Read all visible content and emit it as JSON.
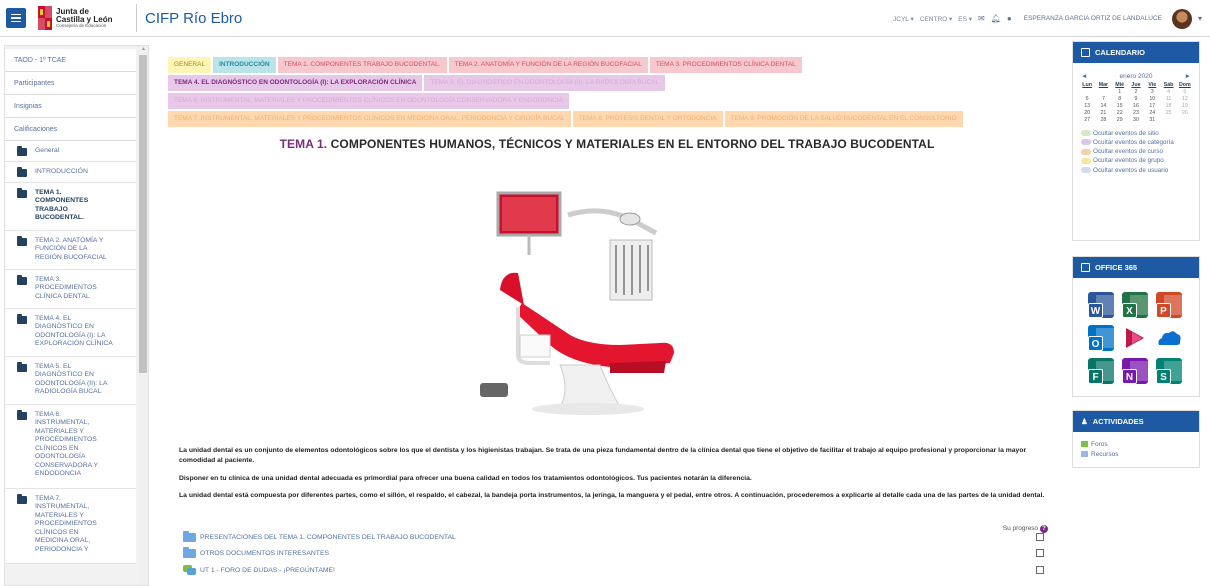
{
  "header": {
    "logo_line1": "Junta de",
    "logo_line2": "Castilla y León",
    "logo_line3": "Consejería de Educación",
    "site_name": "CIFP Río Ebro",
    "nav_jcyl": "JCYL",
    "nav_centro": "CENTRO",
    "nav_lang": "ES",
    "user_name": "ESPERANZA GARCIA ORTIZ DE LANDALUCE"
  },
  "drawer": {
    "course": "TAOD - 1º TCAE",
    "links": [
      "Participantes",
      "Insignias",
      "Calificaciones"
    ],
    "sections": [
      {
        "label": "General",
        "lines": [
          "General"
        ]
      },
      {
        "label": "INTRODUCCIÓN",
        "lines": [
          "INTRODUCCIÓN"
        ]
      },
      {
        "label": "TEMA 1. COMPONENTES TRABAJO BUCODENTAL.",
        "lines": [
          "TEMA 1.",
          "COMPONENTES",
          "TRABAJO",
          "BUCODENTAL."
        ],
        "active": true
      },
      {
        "label": "TEMA 2. ANATOMÍA Y FUNCIÓN DE LA REGIÓN BUCOFACIAL",
        "lines": [
          "TEMA 2. ANATOMÍA Y",
          "FUNCIÓN DE LA",
          "REGIÓN BUCOFACIAL"
        ]
      },
      {
        "label": "TEMA 3. PROCEDIMIENTOS CLÍNICA DENTAL",
        "lines": [
          "TEMA 3.",
          "PROCEDIMIENTOS",
          "CLÍNICA DENTAL"
        ]
      },
      {
        "label": "TEMA 4. EL DIAGNÓSTICO EN ODONTOLOGÍA (I): LA EXPLORACIÓN CLÍNICA",
        "lines": [
          "TEMA 4. EL",
          "DIAGNÓSTICO EN",
          "ODONTOLOGÍA (I): LA",
          "EXPLORACIÓN CLÍNICA"
        ]
      },
      {
        "label": "TEMA 5. EL DIAGNÓSTICO EN ODONTOLOGÍA (II): LA RADIOLOGÍA BUCAL",
        "lines": [
          "TEMA 5. EL",
          "DIAGNÓSTICO EN",
          "ODONTOLOGÍA (II): LA",
          "RADIOLOGÍA BUCAL"
        ]
      },
      {
        "label": "TEMA 6. INSTRUMENTAL, MATERIALES Y PROCEDIMIENTOS CLÍNICOS EN ODONTOLOGÍA CONSERVADORA Y ENDODONCIA",
        "lines": [
          "TEMA 6.",
          "INSTRUMENTAL,",
          "MATERIALES Y",
          "PROCEDIMIENTOS",
          "CLÍNICOS EN",
          "ODONTOLOGÍA",
          "CONSERVADORA Y",
          "ENDODONCIA"
        ]
      },
      {
        "label": "TEMA 7. INSTRUMENTAL, MATERIALES Y PROCEDIMIENTOS CLÍNICOS EN MEDICINA ORAL, PERIODONCIA Y",
        "lines": [
          "TEMA 7.",
          "INSTRUMENTAL,",
          "MATERIALES Y",
          "PROCEDIMIENTOS",
          "CLÍNICOS EN",
          "MEDICINA ORAL,",
          "PERIODONCIA Y"
        ]
      }
    ]
  },
  "tabs": {
    "row1": [
      "General",
      "INTRODUCCIÓN",
      "TEMA 1. COMPONENTES TRABAJO BUCODENTAL.",
      "TEMA 2. ANATOMÍA Y FUNCIÓN DE LA REGIÓN BUCOFACIAL",
      "TEMA 3. PROCEDIMIENTOS CLÍNICA DENTAL"
    ],
    "row2": [
      "TEMA 4. EL DIAGNÓSTICO EN ODONTOLOGÍA (I): LA EXPLORACIÓN CLÍNICA",
      "TEMA 5. EL DIAGNÓSTICO EN ODONTOLOGÍA (II): LA RADIOLOGÍA BUCAL"
    ],
    "row3": [
      "TEMA 6. INSTRUMENTAL, MATERIALES Y PROCEDIMIENTOS CLÍNICOS EN ODONTOLOGÍA CONSERVADORA Y ENDODONCIA"
    ],
    "row4": [
      "TEMA 7. INSTRUMENTAL, MATERIALES Y PROCEDIMIENTOS CLÍNICOS EN MEDICINA ORAL, PERIODONCIA Y CIRUGÍA BUCAL",
      "TEMA 8. PRÓTESIS DENTAL Y ORTODONCIA",
      "TEMA 9. PROMOCIÓN DE LA SALUD BUCODENTAL EN EL CONSULTORIO"
    ]
  },
  "content": {
    "title_prefix": "TEMA 1.",
    "title_rest": " COMPONENTES HUMANOS, TÉCNICOS Y MATERIALES EN EL ENTORNO DEL TRABAJO BUCODENTAL",
    "para1": "La unidad dental es un conjunto de elementos odontológicos sobre los que el dentista y los higienistas trabajan. Se trata de una pieza fundamental dentro de la clínica dental que tiene el objetivo de facilitar el trabajo al equipo profesional y proporcionar la mayor comodidad al paciente.",
    "para2": "Disponer en tu clínica de una unidad dental adecuada es primordial para ofrecer una buena calidad en todos los tratamientos odontológicos. Tus pacientes notarán la diferencia.",
    "para3": "La unidad dental está compuesta por diferentes partes, como el sillón, el respaldo, el cabezal, la bandeja porta instrumentos, la jeringa, la manguera y el pedal, entre otros. A continuación, procederemos a explicarte al detalle cada una de las partes de la unidad dental.",
    "progress_label": "Su progreso",
    "activities": [
      {
        "name": "PRESENTACIONES DEL TEMA 1. COMPONENTES DEL TRABAJO BUCODENTAL",
        "icon": "folder"
      },
      {
        "name": "OTROS DOCUMENTOS INTERESANTES",
        "icon": "folder"
      },
      {
        "name": "UT 1 - FORO DE DUDAS - ¡PREGÚNTAME!",
        "icon": "forum"
      }
    ]
  },
  "calendar": {
    "title": "CALENDARIO",
    "month": "enero 2020",
    "prev": "◄",
    "next": "►",
    "days": [
      "Lun",
      "Mar",
      "Mié",
      "Jue",
      "Vie",
      "Sáb",
      "Dom"
    ],
    "weeks": [
      [
        "",
        "",
        "1",
        "2",
        "3",
        "4",
        "5"
      ],
      [
        "6",
        "7",
        "8",
        "9",
        "10",
        "11",
        "12"
      ],
      [
        "13",
        "14",
        "15",
        "16",
        "17",
        "18",
        "19"
      ],
      [
        "20",
        "21",
        "22",
        "23",
        "24",
        "25",
        "26"
      ],
      [
        "27",
        "28",
        "29",
        "30",
        "31",
        "",
        ""
      ]
    ],
    "events": [
      "Ocultar eventos de sitio",
      "Ocultar eventos de categoría",
      "Ocultar eventos de curso",
      "Ocultar eventos de grupo",
      "Ocultar eventos de usuario"
    ]
  },
  "office": {
    "title": "OFFICE 365",
    "apps": [
      {
        "name": "word-icon",
        "letter": "W",
        "color": "#2b579a"
      },
      {
        "name": "excel-icon",
        "letter": "X",
        "color": "#217346"
      },
      {
        "name": "powerpoint-icon",
        "letter": "P",
        "color": "#d24726"
      },
      {
        "name": "outlook-icon",
        "letter": "O",
        "color": "#0072c6"
      },
      {
        "name": "stream-icon",
        "letter": "",
        "color": "#bc1948"
      },
      {
        "name": "onedrive-icon",
        "letter": "",
        "color": "#0a6fd1"
      },
      {
        "name": "forms-icon",
        "letter": "F",
        "color": "#077568"
      },
      {
        "name": "onenote-icon",
        "letter": "N",
        "color": "#7719aa"
      },
      {
        "name": "sway-icon",
        "letter": "S",
        "color": "#008272"
      }
    ]
  },
  "activities_block": {
    "title": "ACTIVIDADES",
    "items": [
      "Foros",
      "Recursos"
    ]
  }
}
